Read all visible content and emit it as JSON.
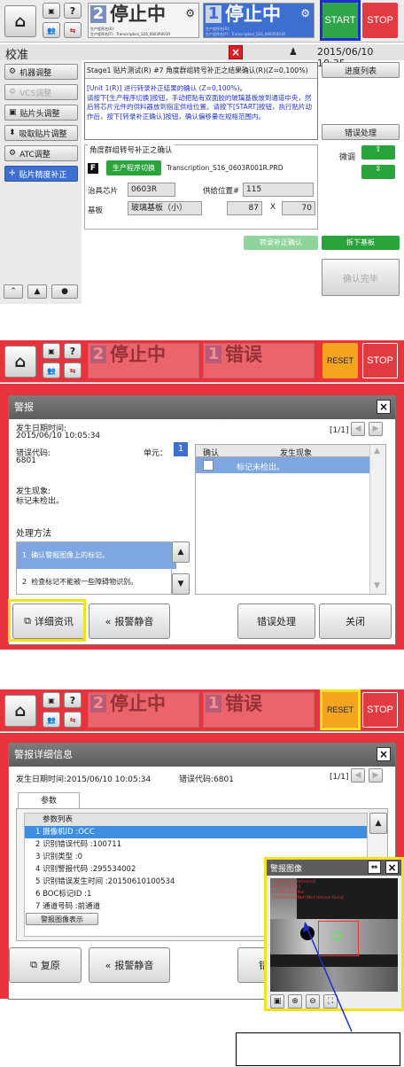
{
  "panel1": {
    "header": {
      "status_left_num": "2",
      "status_left": "停止中",
      "status_left_sub1": "生产程序名(R)：",
      "status_left_sub2": "生产程序名(F)：Transcription_S16_0603R001R",
      "status_right_num": "1",
      "status_right": "停止中",
      "status_right_sub1": "生产程序名(R)：",
      "status_right_sub2": "生产程序名(F)：Transcription_S16_0603R001R",
      "start": "START",
      "stop": "STOP"
    },
    "titlebar": {
      "title": "校准",
      "datetime": "2015/06/10 10:35"
    },
    "sidebar": [
      "机器调整",
      "VCS调整",
      "贴片头调整",
      "吸取贴片调整",
      "ATC调整",
      "贴片精度补正"
    ],
    "info_title": "Stage1 贴片测试(R) #7 角度群组转号补正之结果确认(R)(Z=0,100%)",
    "info_text": "[Unit 1(R)] 进行转录补正结果的确认 (Z=0,100%)。\n请按下[生产程序切换]按钮，手动把贴有双面胶的玻璃基板放到通道中央，然后将芯片元件的供料器放到指定供给位置。请按下[START]按钮，执行贴片动作后，按下[转录补正确认]按钮，确认偏移量在规格范围内。",
    "progress_btn": "进度列表",
    "error_btn": "错误处理",
    "group_title": "角度群组转号补正之确认",
    "f_badge": "F",
    "switch_btn": "生产程序切换",
    "program": "Transcription_S16_0603R001R.PRD",
    "jig_label": "治具芯片",
    "jig_value": "0603R",
    "feed_label": "供给位置#",
    "feed_value": "115",
    "board_label": "基板",
    "board_value": "玻璃基板（小）",
    "size_w": "87",
    "size_x": "X",
    "size_h": "70",
    "fine_label": "微调",
    "confirm_btn": "转录补正确认",
    "unload_btn": "拆下基板",
    "done_btn": "确认完毕"
  },
  "panel2": {
    "header": {
      "status_left_num": "2",
      "status_left": "停止中",
      "status_right_num": "1",
      "status_right": "错误",
      "reset": "RESET",
      "stop": "STOP"
    },
    "title": "警报",
    "time_label": "发生日期时间:",
    "time_value": "2015/06/10 10:05:34",
    "page": "[1/1]",
    "code_label": "错误代码:",
    "code_value": "6801",
    "unit_label": "单元：",
    "unit_value": "1",
    "phen_label": "发生现象:",
    "phen_value": "标记未检出。",
    "table_head": [
      "确认",
      "发生现象"
    ],
    "table_row": "标记未检出。",
    "method_label": "处理方法",
    "methods": [
      {
        "num": "1",
        "text": "确认警报图像上的标记。"
      },
      {
        "num": "2",
        "text": "检查标记不能被一些障碍物识别。"
      }
    ],
    "btn_detail": "详细资讯",
    "btn_mute": "报警静音",
    "btn_err": "错误处理",
    "btn_close": "关闭"
  },
  "panel3": {
    "header": {
      "status_left_num": "2",
      "status_left": "停止中",
      "status_right_num": "1",
      "status_right": "错误",
      "reset": "RESET",
      "stop": "STOP"
    },
    "title": "警报详细信息",
    "time_text": "发生日期时间:2015/06/10 10:05:34",
    "code_text": "错误代码:6801",
    "page": "[1/1]",
    "tab": "参数",
    "param_head": "参数列表",
    "params": [
      "1 摄像机ID :OCC",
      "2 识别错误代码 :100711",
      "3 识别类型 :0",
      "4 识别警报代码 :295534002",
      "5 识别错误发生时间 :20150610100534",
      "6 BOC标记ID :1",
      "7 通道号码 :前通道"
    ],
    "show_img_btn": "警报图像表示",
    "btn_restore": "复原",
    "btn_mute": "报警静音",
    "btn_partial": "错",
    "img_title": "警报图像",
    "img_text": [
      "RecogNo:Mark(mm):0",
      "BOC:0.100711",
      "Pos No:-18/1Pos",
      "FiducialmarkNot:(No.f:d)mark found"
    ]
  },
  "colors": {
    "accent_blue": "#3158c8",
    "highlight": "#f2e11e",
    "alarm_red": "#e8323c",
    "green": "#28a43a",
    "start_green": "#2fa44a",
    "stop_red": "#e23a43",
    "reset_orange": "#f5a41f"
  }
}
